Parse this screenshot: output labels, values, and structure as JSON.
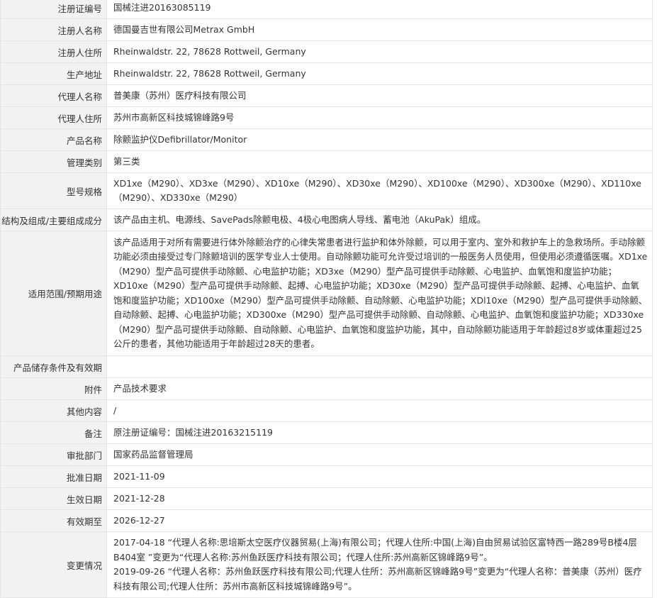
{
  "rows": [
    {
      "label": "注册证编号",
      "value": "国械注进20163085119"
    },
    {
      "label": "注册人名称",
      "value": "德国曼吉世有限公司Metrax GmbH"
    },
    {
      "label": "注册人住所",
      "value": "Rheinwaldstr. 22, 78628 Rottweil, Germany"
    },
    {
      "label": "生产地址",
      "value": "Rheinwaldstr. 22, 78628 Rottweil, Germany"
    },
    {
      "label": "代理人名称",
      "value": "普美康（苏州）医疗科技有限公司"
    },
    {
      "label": "代理人住所",
      "value": "苏州市高新区科技城锦峰路9号"
    },
    {
      "label": "产品名称",
      "value": "除颤监护仪Defibrillator/Monitor"
    },
    {
      "label": "管理类别",
      "value": "第三类"
    },
    {
      "label": "型号规格",
      "value": "XD1xe（M290）、XD3xe（M290）、XD10xe（M290）、XD30xe（M290）、XD100xe（M290）、XD300xe（M290）、XD110xe（M290）、XD330xe（M290）"
    },
    {
      "label": "结构及组成/主要组成成分",
      "value": "该产品由主机、电源线、SavePads除颤电极、4极心电图病人导线、蓄电池（AkuPak）组成。"
    },
    {
      "label": "适用范围/预期用途",
      "value": "该产品适用于对所有需要进行体外除颤治疗的心律失常患者进行监护和体外除颤，可以用于室内、室外和救护车上的急救场所。手动除颤功能必须由接受过专门除颤培训的医学专业人士使用。自动除颤功能可允许受过培训的一般医务人员使用，但使用必须遵循医嘱。XD1xe（M290）型产品可提供手动除颤、心电监护功能；XD3xe（M290）型产品可提供手动除颤、心电监护、血氧饱和度监护功能；XD10xe（M290）型产品可提供手动除颤、起搏、心电监护功能；XD30xe（M290）型产品可提供手动除颤、起搏、心电监护、血氧饱和度监护功能；XD100xe（M290）型产品可提供手动除颤、自动除颤、心电监护功能；XDl10xe（M290）型产品可提供手动除颤、自动除颤、起搏、心电监护功能；XD300xe（M290）型产品可提供手动除颤、自动除颤、心电监护、血氧饱和度监护功能；XD330xe（M290）型产品可提供手动除颤、自动除颤、心电监护、血氧饱和度监护功能，其中，自动除颤功能适用于年龄超过8岁或体重超过25公斤的患者，其他功能适用于年龄超过28天的患者。"
    },
    {
      "label": "产品储存条件及有效期",
      "value": ""
    },
    {
      "label": "附件",
      "value": "产品技术要求"
    },
    {
      "label": "其他内容",
      "value": "/"
    },
    {
      "label": "备注",
      "value": "原注册证编号：国械注进20163215119"
    },
    {
      "label": "审批部门",
      "value": "国家药品监督管理局"
    },
    {
      "label": "批准日期",
      "value": "2021-11-09"
    },
    {
      "label": "生效日期",
      "value": "2021-12-28"
    },
    {
      "label": "有效期至",
      "value": "2026-12-27"
    }
  ],
  "changes": {
    "label": "变更情况",
    "entries": [
      "2017-04-18 “代理人名称:思培斯太空医疗仪器贸易(上海)有限公司；代理人住所:中国(上海)自由贸易试验区富特西一路289号B楼4层B404室 ”变更为“代理人名称:苏州鱼跃医疗科技有限公司；代理人住所:苏州高新区锦峰路9号”。",
      "2019-09-26 “代理人名称：苏州鱼跃医疗科技有限公司;代理人住所：苏州高新区锦峰路9号”变更为“代理人名称：普美康（苏州）医疗科技有限公司;代理人住所：苏州市高新区科技城锦峰路9号”。"
    ]
  }
}
